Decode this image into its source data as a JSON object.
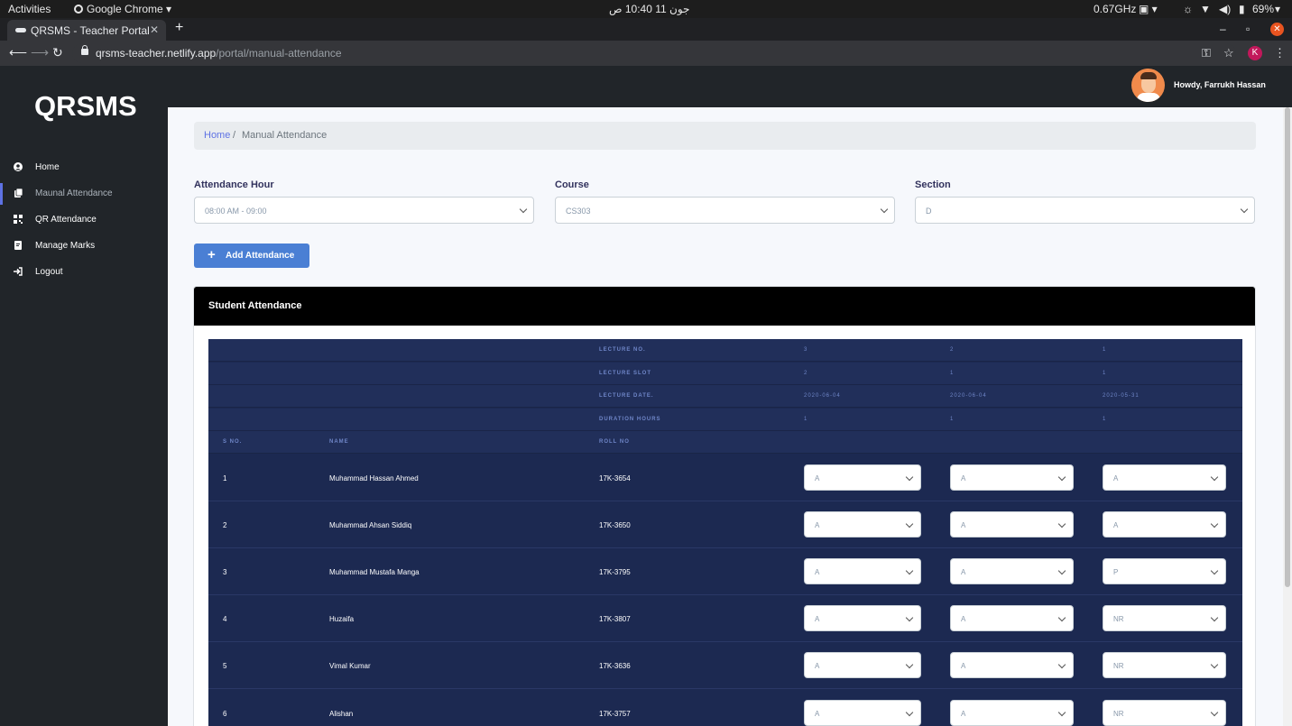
{
  "os": {
    "activities": "Activities",
    "app_menu": "Google Chrome ▾",
    "clock": "جون 11  10:40 ص",
    "cpu": "0.67GHz",
    "battery": "69%"
  },
  "browser": {
    "tab_title": "QRSMS - Teacher Portal",
    "url_host": "qrsms-teacher.netlify.app",
    "url_path": "/portal/manual-attendance",
    "profile_initial": "K"
  },
  "app": {
    "brand": "QRSMS",
    "greeting": "Howdy, Farrukh Hassan",
    "sidebar": [
      {
        "label": "Home",
        "icon": "user-circle-icon"
      },
      {
        "label": "Maunal Attendance",
        "icon": "clipboard-icon",
        "active": true
      },
      {
        "label": "QR Attendance",
        "icon": "qr-code-icon"
      },
      {
        "label": "Manage Marks",
        "icon": "document-icon"
      },
      {
        "label": "Logout",
        "icon": "sign-out-icon"
      }
    ],
    "breadcrumb": {
      "home": "Home",
      "separator": "/",
      "current": "Manual Attendance"
    },
    "filters": {
      "hour_label": "Attendance Hour",
      "hour_value": "08:00 AM - 09:00",
      "course_label": "Course",
      "course_value": "CS303",
      "section_label": "Section",
      "section_value": "D"
    },
    "add_button": "Add Attendance",
    "card_title": "Student Attendance",
    "table": {
      "meta_rows": [
        {
          "label": "LECTURE NO.",
          "values": [
            "3",
            "2",
            "1"
          ]
        },
        {
          "label": "LECTURE SLOT",
          "values": [
            "2",
            "1",
            "1"
          ]
        },
        {
          "label": "LECTURE DATE.",
          "values": [
            "2020-06-04",
            "2020-06-04",
            "2020-05-31"
          ]
        },
        {
          "label": "DURATION HOURS",
          "values": [
            "1",
            "1",
            "1"
          ]
        }
      ],
      "headers": {
        "sno": "S NO.",
        "name": "NAME",
        "roll": "ROLL NO"
      },
      "rows": [
        {
          "sno": "1",
          "name": "Muhammad Hassan Ahmed",
          "roll": "17K-3654",
          "att": [
            "A",
            "A",
            "A"
          ]
        },
        {
          "sno": "2",
          "name": "Muhammad Ahsan Siddiq",
          "roll": "17K-3650",
          "att": [
            "A",
            "A",
            "A"
          ]
        },
        {
          "sno": "3",
          "name": "Muhammad Mustafa Manga",
          "roll": "17K-3795",
          "att": [
            "A",
            "A",
            "P"
          ]
        },
        {
          "sno": "4",
          "name": "Huzaifa",
          "roll": "17K-3807",
          "att": [
            "A",
            "A",
            "NR"
          ]
        },
        {
          "sno": "5",
          "name": "Vimal Kumar",
          "roll": "17K-3636",
          "att": [
            "A",
            "A",
            "NR"
          ]
        },
        {
          "sno": "6",
          "name": "Alishan",
          "roll": "17K-3757",
          "att": [
            "A",
            "A",
            "NR"
          ]
        }
      ]
    }
  }
}
